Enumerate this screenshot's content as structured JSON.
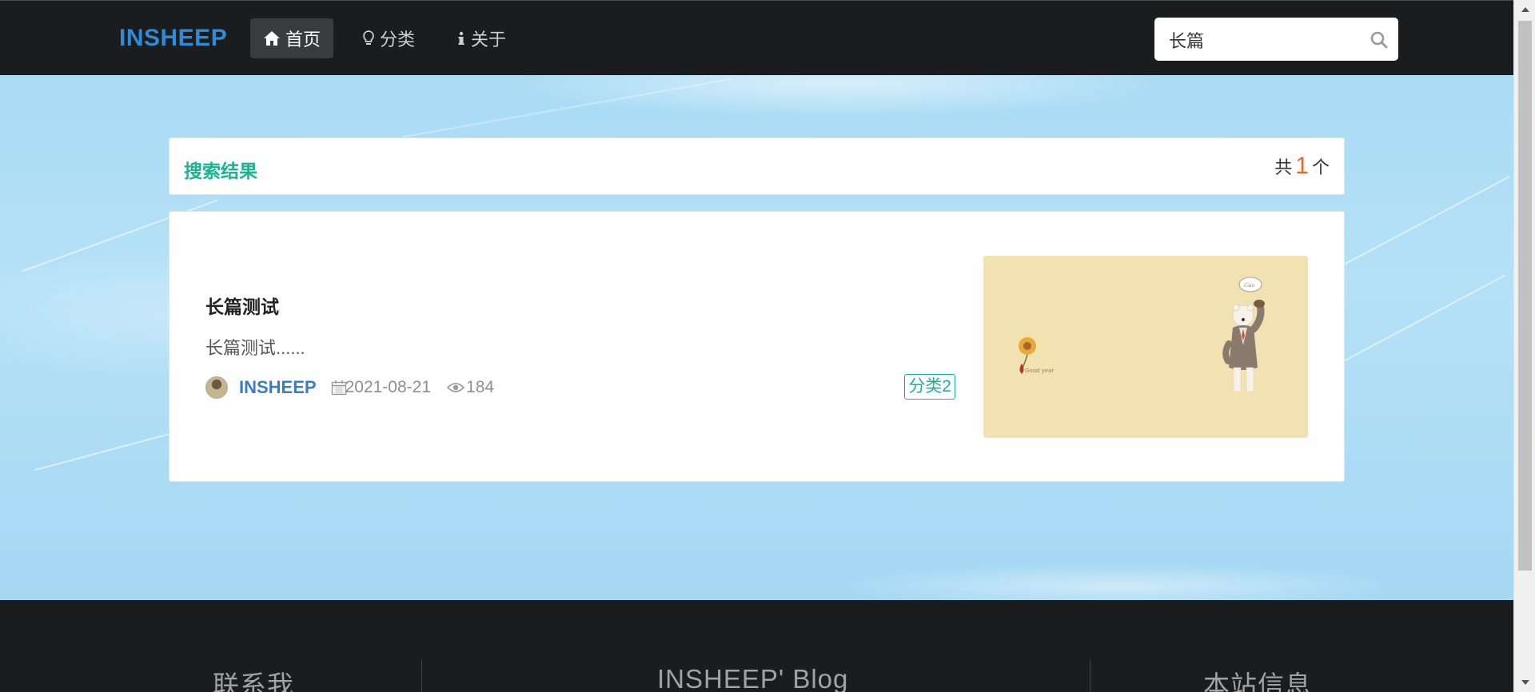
{
  "nav": {
    "brand": "INSHEEP",
    "items": [
      {
        "label": "首页",
        "icon": "home-icon",
        "active": true
      },
      {
        "label": "分类",
        "icon": "lightbulb-icon",
        "active": false
      },
      {
        "label": "关于",
        "icon": "info-icon",
        "active": false
      }
    ],
    "search": {
      "value": "长篇",
      "icon": "search-icon"
    }
  },
  "results": {
    "title": "搜索结果",
    "count_prefix": "共",
    "count": "1",
    "count_suffix": "个"
  },
  "article": {
    "title": "长篇测试",
    "summary": "长篇测试......",
    "author": "INSHEEP",
    "date": "2021-08-21",
    "views": "184",
    "category_tag": "分类2",
    "thumbnail": "illustration of a polar bear in a suit and a sunflower on a pale yellow background"
  },
  "footer": {
    "columns": [
      "联系我",
      "INSHEEP' Blog",
      "本站信息"
    ]
  },
  "colors": {
    "brand": "#2f8bd8",
    "accent_green": "#1ab394",
    "count_orange": "#e8672a",
    "nav_bg": "#1b1c1e"
  }
}
